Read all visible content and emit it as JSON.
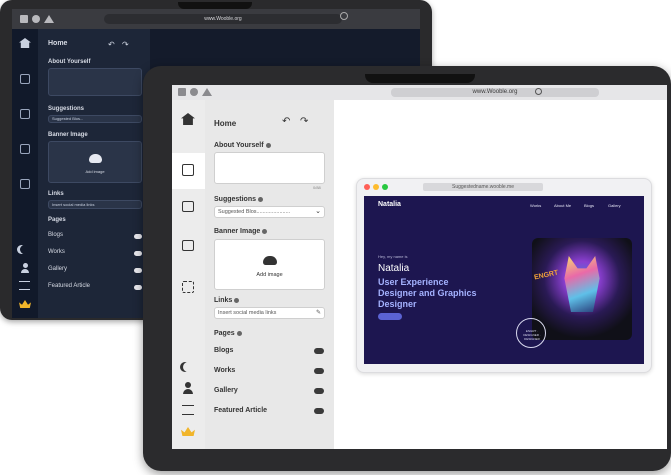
{
  "back_device": {
    "url": "www.Wooble.org",
    "panel": {
      "title": "Home",
      "about_label": "About Yourself",
      "suggestions_label": "Suggestions",
      "suggestions_value": "Suggested Blos...",
      "banner_label": "Banner Image",
      "add_image": "Add image",
      "links_label": "Links",
      "links_placeholder": "Insert social media links",
      "pages_label": "Pages",
      "pages": [
        "Blogs",
        "Works",
        "Gallery",
        "Featured Article"
      ]
    }
  },
  "front_device": {
    "url": "www.Wooble.org",
    "panel": {
      "title": "Home",
      "about_label": "About Yourself",
      "about_counter": "0/88",
      "suggestions_label": "Suggestions",
      "suggestions_value": "Suggested Blos......................",
      "banner_label": "Banner Image",
      "add_image": "Add image",
      "links_label": "Links",
      "links_placeholder": "Insert social media links",
      "pages_label": "Pages",
      "pages": [
        "Blogs",
        "Works",
        "Gallery",
        "Featured Article"
      ]
    },
    "preview": {
      "url": "Suggestedname.wooble.me",
      "site_name": "Natalia",
      "nav": [
        "Works",
        "About Me",
        "Blogs",
        "Gallery"
      ],
      "greeting": "Hey, my name is",
      "name": "Natalia",
      "headline": "User Experience Designer and Graphics Designer",
      "badge_text": "ENGRT · DESIGNER · DESIGNER"
    }
  },
  "colors": {
    "preview_bg": "#1d1650",
    "headline": "#a4b2ff",
    "button": "#5b63d3",
    "toggle_dark": "#3a3a3a",
    "dot_red": "#ff5f57",
    "dot_yellow": "#febc2e",
    "dot_green": "#28c840"
  }
}
